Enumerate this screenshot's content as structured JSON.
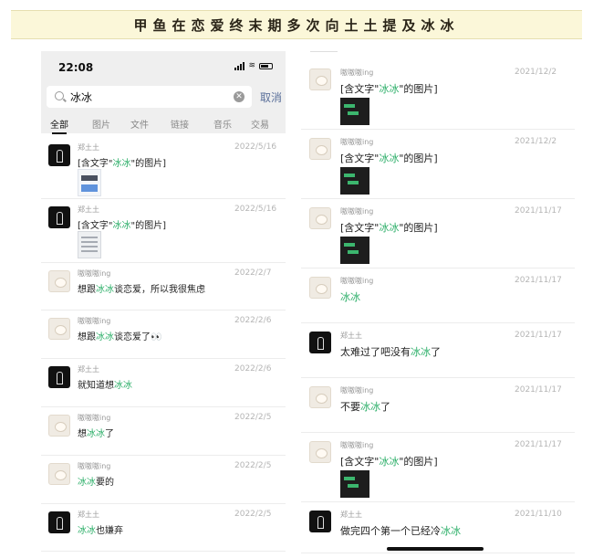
{
  "banner": {
    "title": "甲鱼在恋爱终末期多次向土土提及冰冰"
  },
  "status": {
    "time": "22:08"
  },
  "search": {
    "query": "冰冰",
    "cancel_label": "取消"
  },
  "tabs": [
    "全部",
    "图片",
    "文件",
    "链接",
    "音乐",
    "交易"
  ],
  "left_results": [
    {
      "name": "郑土土",
      "date": "2022/5/16",
      "pre": "[含文字\"",
      "hl": "冰冰",
      "post": "\"的图片]",
      "avatar": "dark",
      "thumb": "pic1"
    },
    {
      "name": "郑土土",
      "date": "2022/5/16",
      "pre": "[含文字\"",
      "hl": "冰冰",
      "post": "\"的图片]",
      "avatar": "dark",
      "thumb": "pic2"
    },
    {
      "name": "嗷嗷嗷ing",
      "date": "2022/2/7",
      "pre": "想跟",
      "hl": "冰冰",
      "post": "谈恋爱，所以我很焦虑",
      "avatar": "light"
    },
    {
      "name": "嗷嗷嗷ing",
      "date": "2022/2/6",
      "pre": "想跟",
      "hl": "冰冰",
      "post": "谈恋爱了👀",
      "avatar": "light"
    },
    {
      "name": "郑土土",
      "date": "2022/2/6",
      "pre": "就知道想",
      "hl": "冰冰",
      "post": "",
      "avatar": "dark"
    },
    {
      "name": "嗷嗷嗷ing",
      "date": "2022/2/5",
      "pre": "想",
      "hl": "冰冰",
      "post": "了",
      "avatar": "light"
    },
    {
      "name": "嗷嗷嗷ing",
      "date": "2022/2/5",
      "pre": "",
      "hl": "冰冰",
      "post": "要的",
      "avatar": "light"
    },
    {
      "name": "郑土土",
      "date": "2022/2/5",
      "pre": "",
      "hl": "冰冰",
      "post": "也嫌弃",
      "avatar": "dark"
    }
  ],
  "right_results": [
    {
      "name": "嗷嗷嗷ing",
      "date": "2021/12/2",
      "pre": "[含文字\"",
      "hl": "冰冰",
      "post": "\"的图片]",
      "avatar": "light",
      "thumb": "dark"
    },
    {
      "name": "嗷嗷嗷ing",
      "date": "2021/12/2",
      "pre": "[含文字\"",
      "hl": "冰冰",
      "post": "\"的图片]",
      "avatar": "light",
      "thumb": "dark"
    },
    {
      "name": "嗷嗷嗷ing",
      "date": "2021/11/17",
      "pre": "[含文字\"",
      "hl": "冰冰",
      "post": "\"的图片]",
      "avatar": "light",
      "thumb": "dark"
    },
    {
      "name": "嗷嗷嗷ing",
      "date": "2021/11/17",
      "pre": "",
      "hl": "冰冰",
      "post": "",
      "avatar": "light"
    },
    {
      "name": "郑土土",
      "date": "2021/11/17",
      "pre": "太难过了吧没有",
      "hl": "冰冰",
      "post": "了",
      "avatar": "dark"
    },
    {
      "name": "嗷嗷嗷ing",
      "date": "2021/11/17",
      "pre": "不要",
      "hl": "冰冰",
      "post": "了",
      "avatar": "light"
    },
    {
      "name": "嗷嗷嗷ing",
      "date": "2021/11/17",
      "pre": "[含文字\"",
      "hl": "冰冰",
      "post": "\"的图片]",
      "avatar": "light",
      "thumb": "dark"
    },
    {
      "name": "郑土土",
      "date": "2021/11/10",
      "pre": "做完四个第一个已经冷",
      "hl": "冰冰",
      "post": "",
      "avatar": "dark"
    }
  ]
}
